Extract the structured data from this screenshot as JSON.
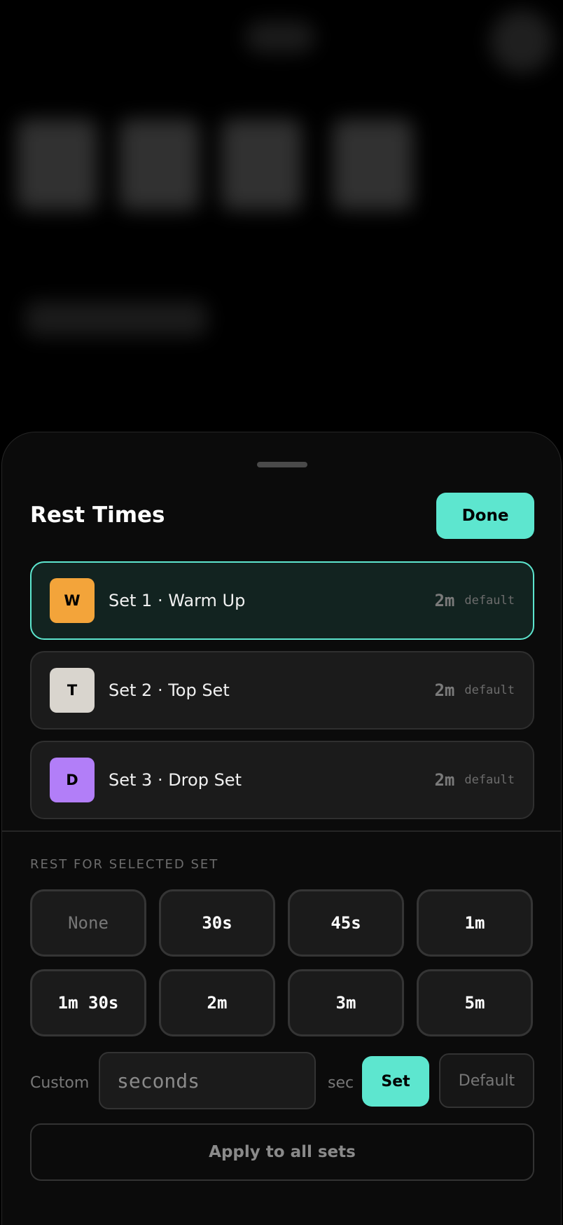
{
  "sheet": {
    "title": "Rest Times",
    "done_label": "Done",
    "sets": [
      {
        "badge": "W",
        "badge_color": "#f3a43a",
        "label": "Set 1 · Warm Up",
        "value": "2m",
        "tag": "default",
        "selected": true
      },
      {
        "badge": "T",
        "badge_color": "#d9d5ce",
        "label": "Set 2 · Top Set",
        "value": "2m",
        "tag": "default",
        "selected": false
      },
      {
        "badge": "D",
        "badge_color": "#b27ef8",
        "label": "Set 3 · Drop Set",
        "value": "2m",
        "tag": "default",
        "selected": false
      }
    ],
    "section_label": "REST FOR SELECTED SET",
    "options": [
      "None",
      "30s",
      "45s",
      "1m",
      "1m 30s",
      "2m",
      "3m",
      "5m"
    ],
    "custom": {
      "label": "Custom",
      "placeholder": "seconds",
      "unit": "sec",
      "set_label": "Set",
      "default_label": "Default"
    },
    "apply_label": "Apply to all sets"
  },
  "colors": {
    "accent": "#5de6cf",
    "sheet_bg": "#0b0b0b",
    "row_bg": "#1b1b1b"
  }
}
